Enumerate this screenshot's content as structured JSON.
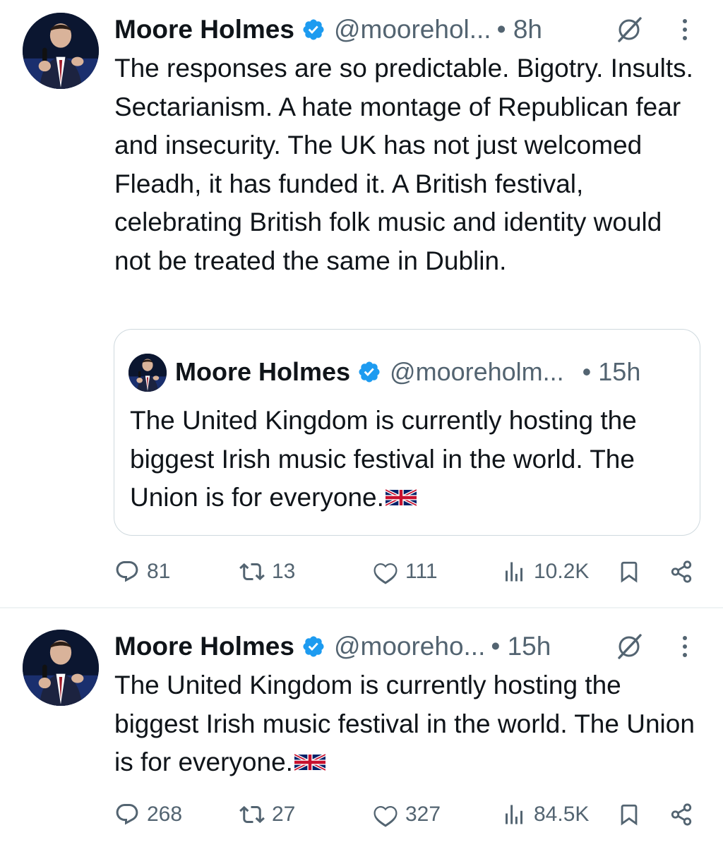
{
  "colors": {
    "verified_badge": "#1d9bf0",
    "secondary_text": "#536471",
    "primary_text": "#0f1419",
    "border": "#cfd9de"
  },
  "tweets": [
    {
      "author": {
        "name": "Moore Holmes",
        "handle": "@moorehol...",
        "verified": true
      },
      "time": "• 8h",
      "text": "The responses are so predictable. Bigotry. Insults. Sectarianism. A hate montage of Republican fear and insecurity. The UK has not just welcomed Fleadh, it has funded it. A British festival, celebrating British folk music and identity would not be treated the same in Dublin.",
      "quote": {
        "author": {
          "name": "Moore Holmes",
          "handle": "@mooreholm...",
          "verified": true
        },
        "time": "• 15h",
        "text": "The United Kingdom is currently hosting the biggest Irish music festival in the world. The Union is for everyone.",
        "emoji": "flag-united-kingdom"
      },
      "stats": {
        "replies": "81",
        "reposts": "13",
        "likes": "111",
        "views": "10.2K"
      }
    },
    {
      "author": {
        "name": "Moore Holmes",
        "handle": "@mooreho...",
        "verified": true
      },
      "time": "• 15h",
      "text": "The United Kingdom is currently hosting the biggest Irish music festival in the world. The Union is for everyone.",
      "emoji": "flag-united-kingdom",
      "stats": {
        "replies": "268",
        "reposts": "27",
        "likes": "327",
        "views": "84.5K"
      }
    }
  ],
  "icons": {
    "verified": "verified-badge-icon",
    "grok": "grok-icon",
    "more": "more-options-icon",
    "reply": "reply-icon",
    "repost": "repost-icon",
    "like": "like-icon",
    "views": "views-icon",
    "bookmark": "bookmark-icon",
    "share": "share-icon"
  }
}
